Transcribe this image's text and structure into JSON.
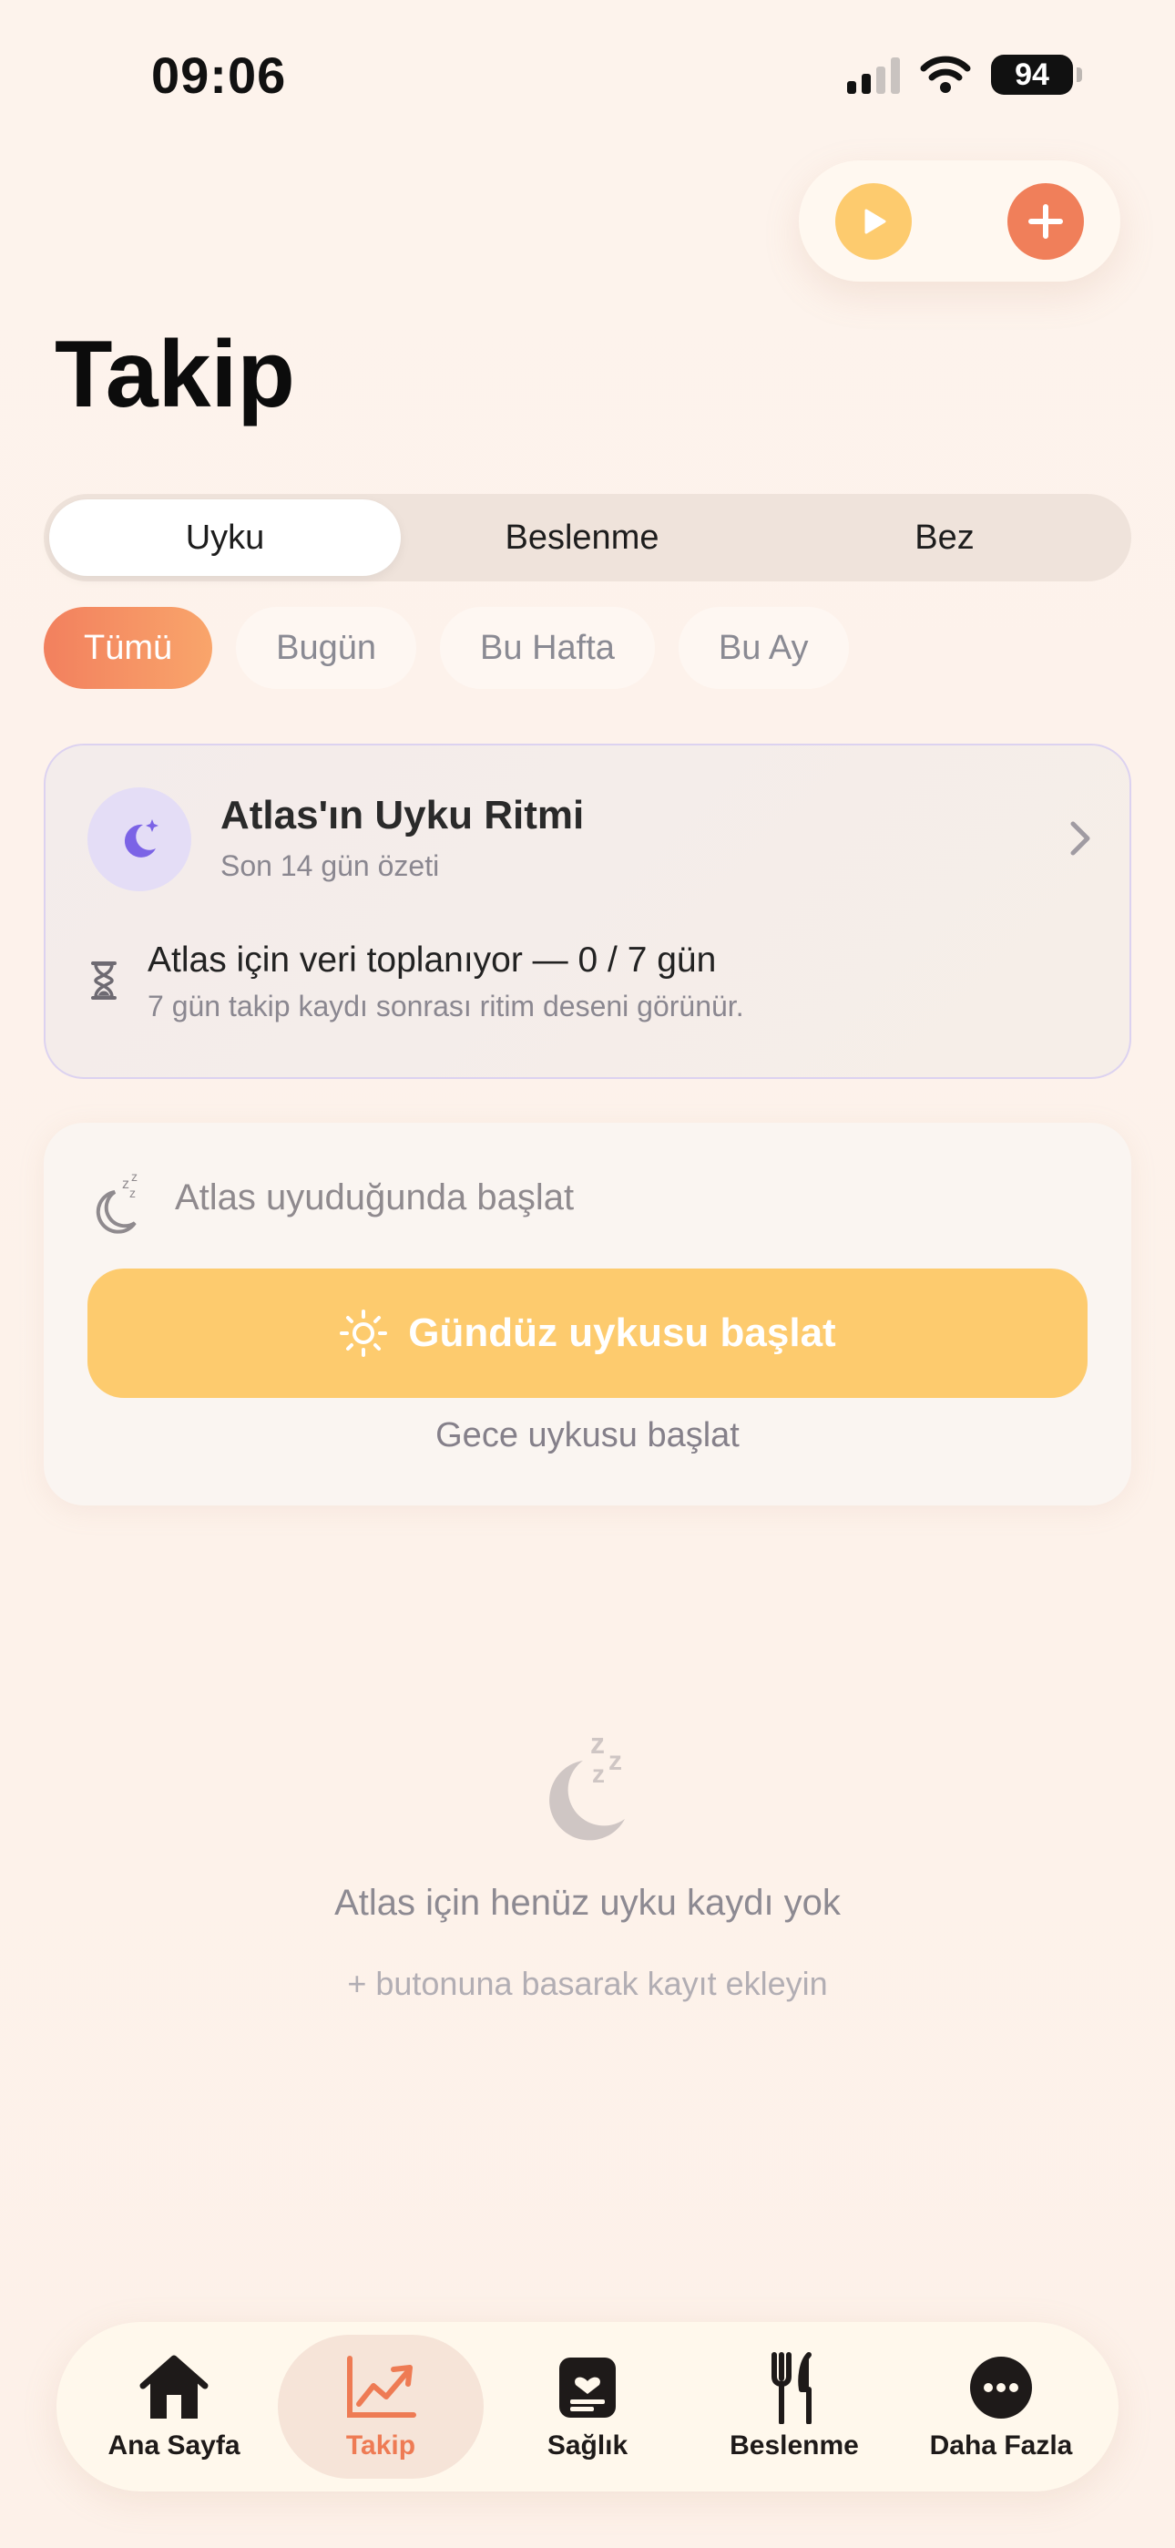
{
  "status_bar": {
    "time": "09:06",
    "battery": "94"
  },
  "header": {
    "title": "Takip",
    "actions": {
      "play_icon": "play-icon",
      "add_icon": "plus-icon"
    }
  },
  "segments": [
    {
      "label": "Uyku",
      "active": true
    },
    {
      "label": "Beslenme",
      "active": false
    },
    {
      "label": "Bez",
      "active": false
    }
  ],
  "filters": [
    {
      "label": "Tümü",
      "active": true
    },
    {
      "label": "Bugün",
      "active": false
    },
    {
      "label": "Bu Hafta",
      "active": false
    },
    {
      "label": "Bu Ay",
      "active": false
    }
  ],
  "rhythm_card": {
    "title": "Atlas'ın Uyku Ritmi",
    "subtitle": "Son 14 gün özeti",
    "progress_text": "Atlas için veri toplanıyor — 0 / 7 gün",
    "hint": "7 gün takip kaydı sonrası ritim deseni görünür."
  },
  "start_card": {
    "label": "Atlas uyuduğunda başlat",
    "nap_button": "Gündüz uykusu başlat",
    "night_link": "Gece uykusu başlat"
  },
  "empty_state": {
    "title": "Atlas için henüz uyku kaydı yok",
    "hint": "+ butonuna basarak kayıt ekleyin"
  },
  "tabbar": [
    {
      "label": "Ana Sayfa",
      "icon": "home-icon",
      "active": false
    },
    {
      "label": "Takip",
      "icon": "chart-icon",
      "active": true
    },
    {
      "label": "Sağlık",
      "icon": "health-icon",
      "active": false
    },
    {
      "label": "Beslenme",
      "icon": "fork-knife-icon",
      "active": false
    },
    {
      "label": "Daha Fazla",
      "icon": "more-icon",
      "active": false
    }
  ],
  "colors": {
    "accent": "#F07F5A",
    "yellow": "#FDCB6E",
    "background": "#FDF3EC",
    "lavender": "#E4DDF6"
  }
}
